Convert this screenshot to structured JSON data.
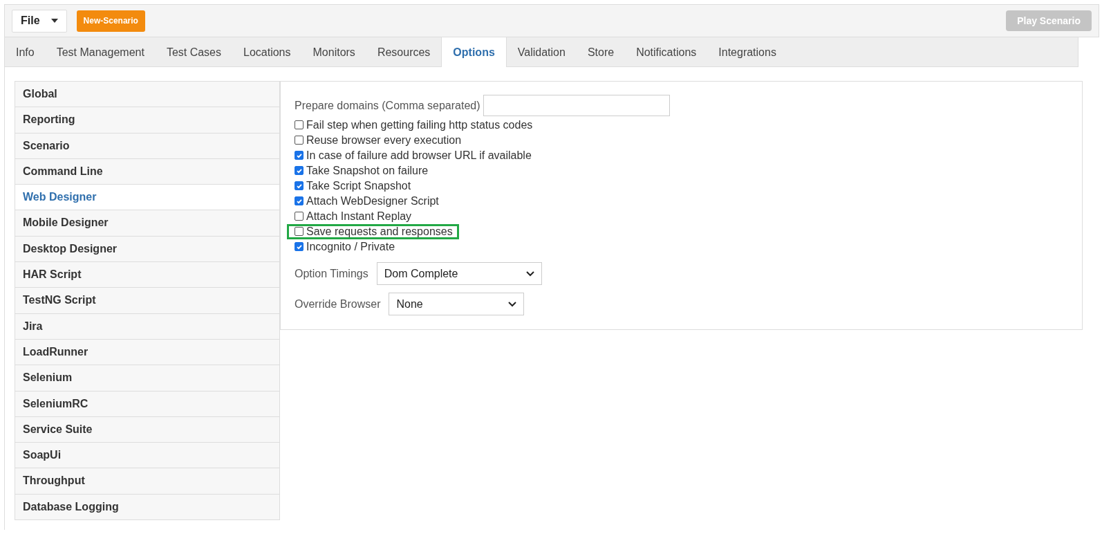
{
  "toolbar": {
    "file_menu": "File",
    "new_button": "New-Scenario",
    "play_button": {
      "label": "Play Scenario",
      "disabled": true
    }
  },
  "tabs": [
    {
      "label": "Info",
      "selected": false
    },
    {
      "label": "Test Management",
      "selected": false
    },
    {
      "label": "Test Cases",
      "selected": false
    },
    {
      "label": "Locations",
      "selected": false
    },
    {
      "label": "Monitors",
      "selected": false
    },
    {
      "label": "Resources",
      "selected": false
    },
    {
      "label": "Options",
      "selected": true
    },
    {
      "label": "Validation",
      "selected": false
    },
    {
      "label": "Store",
      "selected": false
    },
    {
      "label": "Notifications",
      "selected": false
    },
    {
      "label": "Integrations",
      "selected": false
    }
  ],
  "sidebar": {
    "items": [
      {
        "label": "Global",
        "selected": false
      },
      {
        "label": "Reporting",
        "selected": false
      },
      {
        "label": "Scenario",
        "selected": false
      },
      {
        "label": "Command Line",
        "selected": false
      },
      {
        "label": "Web Designer",
        "selected": true
      },
      {
        "label": "Mobile Designer",
        "selected": false
      },
      {
        "label": "Desktop Designer",
        "selected": false
      },
      {
        "label": "HAR Script",
        "selected": false
      },
      {
        "label": "TestNG Script",
        "selected": false
      },
      {
        "label": "Jira",
        "selected": false
      },
      {
        "label": "LoadRunner",
        "selected": false
      },
      {
        "label": "Selenium",
        "selected": false
      },
      {
        "label": "SeleniumRC",
        "selected": false
      },
      {
        "label": "Service Suite",
        "selected": false
      },
      {
        "label": "SoapUi",
        "selected": false
      },
      {
        "label": "Throughput",
        "selected": false
      },
      {
        "label": "Database Logging",
        "selected": false
      }
    ]
  },
  "settings": {
    "domains_label": "Prepare domains (Comma separated)",
    "options": [
      {
        "label": "Fail step when getting failing http status codes",
        "checked": false,
        "highlighted": false
      },
      {
        "label": "Reuse browser every execution",
        "checked": false,
        "highlighted": false
      },
      {
        "label": "In case of failure add browser URL if available",
        "checked": true,
        "highlighted": false
      },
      {
        "label": "Take Snapshot on failure",
        "checked": true,
        "highlighted": false
      },
      {
        "label": "Take Script Snapshot",
        "checked": true,
        "highlighted": false
      },
      {
        "label": "Attach WebDesigner Script",
        "checked": true,
        "highlighted": false
      },
      {
        "label": "Attach Instant Replay",
        "checked": false,
        "highlighted": false
      },
      {
        "label": "Save requests and responses",
        "checked": false,
        "highlighted": true
      },
      {
        "label": "Incognito / Private",
        "checked": true,
        "highlighted": false
      }
    ],
    "selects": [
      {
        "label": "Option Timings",
        "value": "Dom Complete"
      },
      {
        "label": "Override Browser",
        "value": "None"
      }
    ]
  }
}
